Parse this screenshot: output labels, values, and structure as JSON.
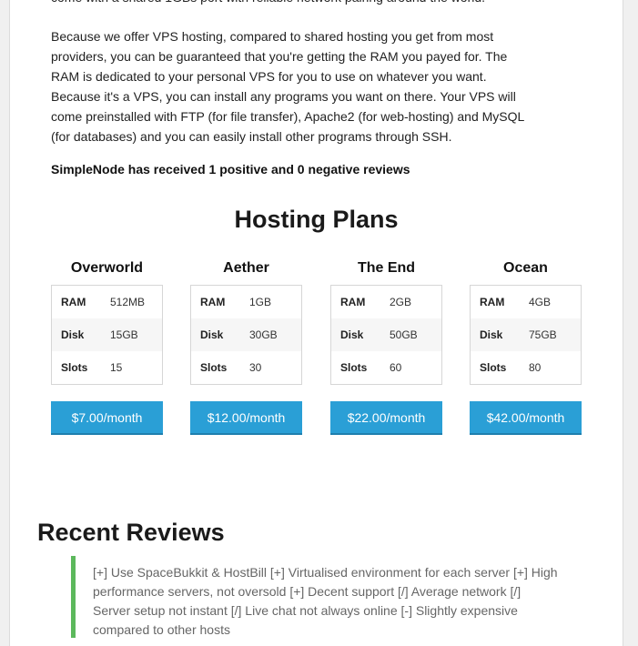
{
  "intro": {
    "cut_line": "come with a shared 1GBs port with reliable network pairing around the world.",
    "paragraph": "Because we offer VPS hosting, compared to shared hosting you get from most providers, you can be guaranteed that you're getting the RAM you payed for. The RAM is dedicated to your personal VPS for you to use on whatever you want. Because it's a VPS, you can install any programs you want on there. Your VPS will come preinstalled with FTP (for file transfer), Apache2 (for web-hosting) and MySQL (for databases) and you can easily install other programs through SSH.",
    "review_summary": "SimpleNode has received 1 positive and 0 negative reviews"
  },
  "plans": {
    "title": "Hosting Plans",
    "items": [
      {
        "name": "Overworld",
        "specs": [
          {
            "key": "RAM",
            "value": "512MB"
          },
          {
            "key": "Disk",
            "value": "15GB"
          },
          {
            "key": "Slots",
            "value": "15"
          }
        ],
        "price": "$7.00/month"
      },
      {
        "name": "Aether",
        "specs": [
          {
            "key": "RAM",
            "value": "1GB"
          },
          {
            "key": "Disk",
            "value": "30GB"
          },
          {
            "key": "Slots",
            "value": "30"
          }
        ],
        "price": "$12.00/month"
      },
      {
        "name": "The End",
        "specs": [
          {
            "key": "RAM",
            "value": "2GB"
          },
          {
            "key": "Disk",
            "value": "50GB"
          },
          {
            "key": "Slots",
            "value": "60"
          }
        ],
        "price": "$22.00/month"
      },
      {
        "name": "Ocean",
        "specs": [
          {
            "key": "RAM",
            "value": "4GB"
          },
          {
            "key": "Disk",
            "value": "75GB"
          },
          {
            "key": "Slots",
            "value": "80"
          }
        ],
        "price": "$42.00/month"
      }
    ]
  },
  "reviews": {
    "title": "Recent Reviews",
    "items": [
      {
        "text": "[+] Use SpaceBukkit & HostBill [+] Virtualised environment for each server [+] High performance servers, not oversold [+] Decent support [/] Average network [/] Server setup not instant [/] Live chat not always online [-] Slightly expensive compared to other hosts",
        "sentiment_color": "#5cb85c"
      }
    ]
  },
  "colors": {
    "button": "#2a9fd6",
    "positive": "#5cb85c"
  }
}
